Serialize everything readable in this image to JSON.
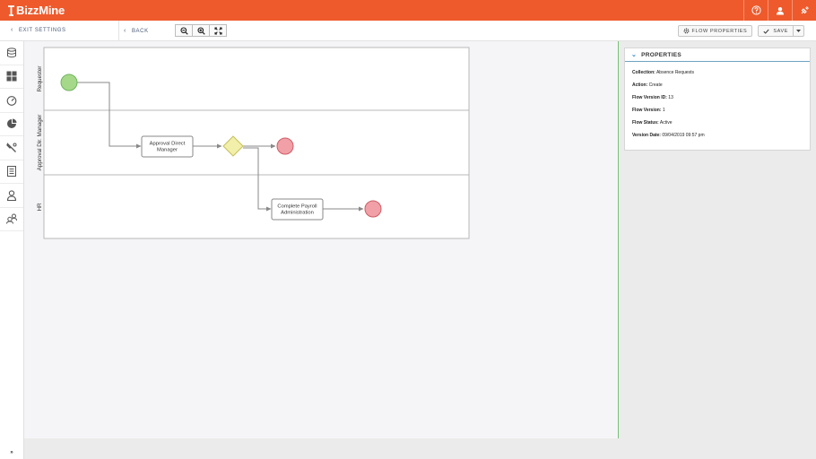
{
  "app": {
    "brand_name": "BizzMine",
    "brand_color": "#ee5a2c"
  },
  "topbar": {
    "icons": [
      "help-icon",
      "user-icon",
      "plug-icon"
    ]
  },
  "subbar": {
    "exit_label": "EXIT SETTINGS",
    "back_label": "BACK",
    "zoom_icons": [
      "zoom-out-icon",
      "zoom-in-icon",
      "fit-screen-icon"
    ],
    "flow_properties_label": "FLOW PROPERTIES",
    "save_label": "SAVE"
  },
  "sidebar": {
    "items": [
      "database-icon",
      "dashboard-icon",
      "gauge-icon",
      "pie-chart-icon",
      "wrench-icon",
      "list-icon",
      "user-outline-icon",
      "users-icon"
    ],
    "collapse_label": "»"
  },
  "diagram": {
    "lanes": [
      {
        "label": "Requester"
      },
      {
        "label": "Approval Dir. Manager"
      },
      {
        "label": "HR"
      }
    ],
    "tasks": [
      {
        "line1": "Approval Direct",
        "line2": "Manager"
      },
      {
        "line1": "Complete Payroll",
        "line2": "Administration"
      }
    ],
    "colors": {
      "start": "#a6d88a",
      "end": "#f0a0a6",
      "gateway": "#f1efaa"
    }
  },
  "properties": {
    "title": "PROPERTIES",
    "rows": [
      {
        "label": "Collection:",
        "value": "Absence Requests"
      },
      {
        "label": "Action:",
        "value": "Create"
      },
      {
        "label": "Flow Version ID:",
        "value": "13"
      },
      {
        "label": "Flow Version:",
        "value": "1"
      },
      {
        "label": "Flow Status:",
        "value": "Active"
      },
      {
        "label": "Version Date:",
        "value": "09/04/2019 09:57 pm"
      }
    ]
  }
}
